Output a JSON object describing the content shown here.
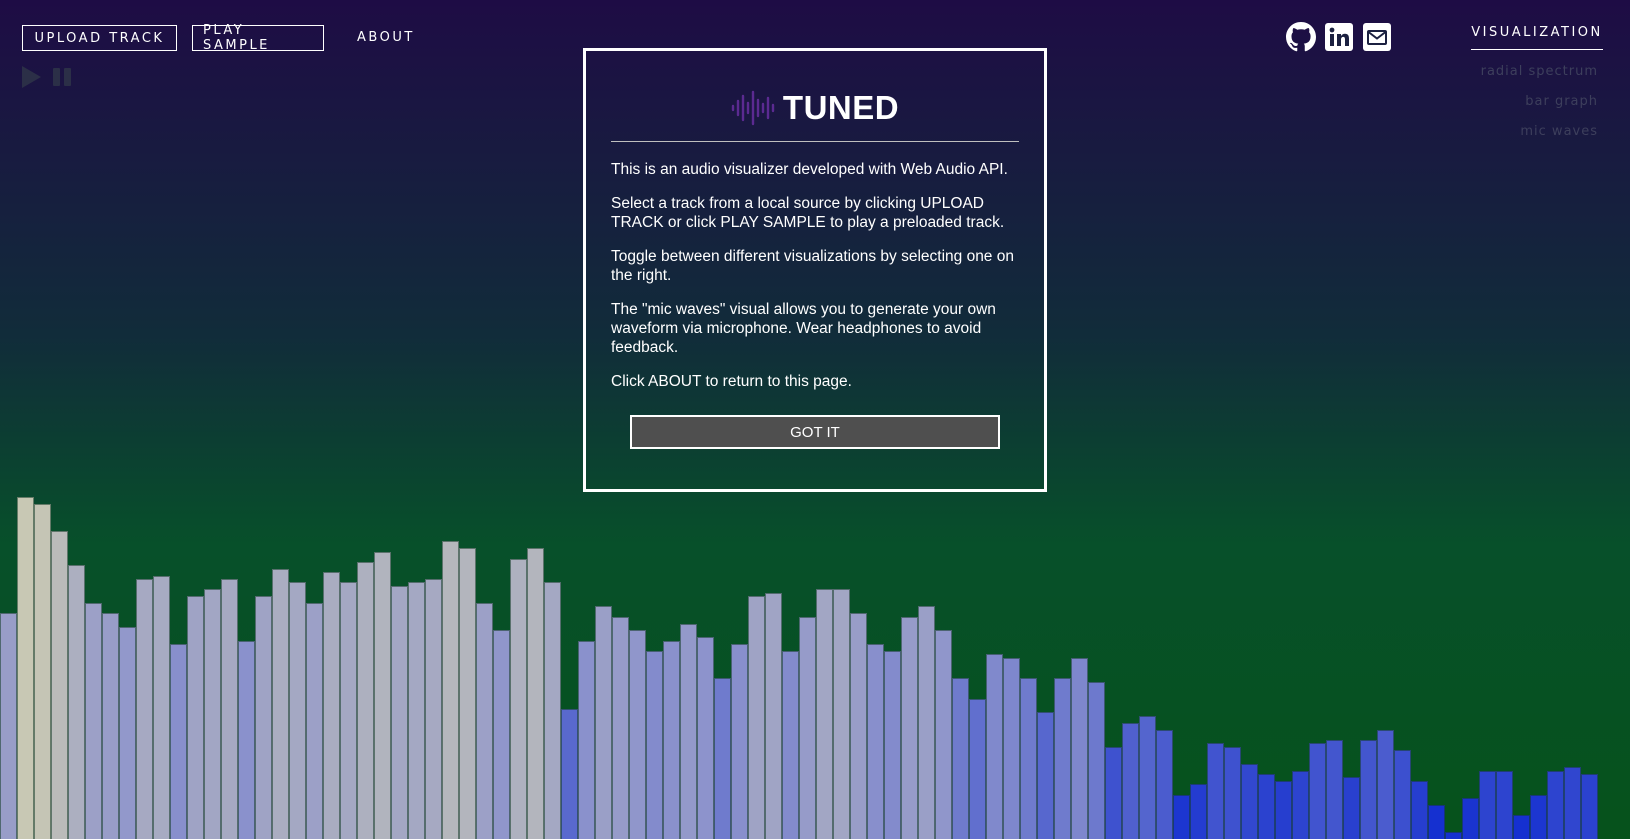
{
  "nav": {
    "upload_label": "UPLOAD TRACK",
    "sample_label": "PLAY SAMPLE",
    "about_label": "ABOUT"
  },
  "transport": {
    "play_icon": "play-icon",
    "pause_icon": "pause-icon"
  },
  "social": [
    "github-icon",
    "linkedin-icon",
    "email-icon"
  ],
  "visualization": {
    "title": "VISUALIZATION",
    "options": [
      "radial spectrum",
      "bar graph",
      "mic waves"
    ]
  },
  "modal": {
    "logo_icon": "waveform-icon",
    "title": "TUNED",
    "paragraphs": [
      "This is an audio visualizer developed with Web Audio API.",
      "Select a track from a local source by clicking UPLOAD TRACK or click PLAY SAMPLE to play a preloaded track.",
      "Toggle between different visualizations by selecting one on the right.",
      "The \"mic waves\" visual allows you to generate your own waveform via microphone. Wear headphones to avoid feedback.",
      "Click ABOUT to return to this page."
    ],
    "button_label": "GOT IT"
  },
  "colors": {
    "accent": "#5b2a91",
    "bar_light": "#c8c8b4",
    "bar_mid": "#8f95cc",
    "bar_dark": "#1530d0"
  },
  "spectrum_levels": [
    0.66,
    1.0,
    0.98,
    0.9,
    0.8,
    0.69,
    0.66,
    0.62,
    0.76,
    0.77,
    0.57,
    0.71,
    0.73,
    0.76,
    0.58,
    0.71,
    0.79,
    0.75,
    0.69,
    0.78,
    0.75,
    0.81,
    0.84,
    0.74,
    0.75,
    0.76,
    0.87,
    0.85,
    0.69,
    0.61,
    0.82,
    0.85,
    0.75,
    0.38,
    0.58,
    0.68,
    0.65,
    0.61,
    0.55,
    0.58,
    0.63,
    0.59,
    0.47,
    0.57,
    0.71,
    0.72,
    0.55,
    0.65,
    0.73,
    0.73,
    0.66,
    0.57,
    0.55,
    0.65,
    0.68,
    0.61,
    0.47,
    0.41,
    0.54,
    0.53,
    0.47,
    0.37,
    0.47,
    0.53,
    0.46,
    0.27,
    0.34,
    0.36,
    0.32,
    0.13,
    0.16,
    0.28,
    0.27,
    0.22,
    0.19,
    0.17,
    0.2,
    0.28,
    0.29,
    0.18,
    0.29,
    0.32,
    0.26,
    0.17,
    0.1,
    0.02,
    0.12,
    0.2,
    0.2,
    0.07,
    0.13,
    0.2,
    0.21,
    0.19
  ]
}
